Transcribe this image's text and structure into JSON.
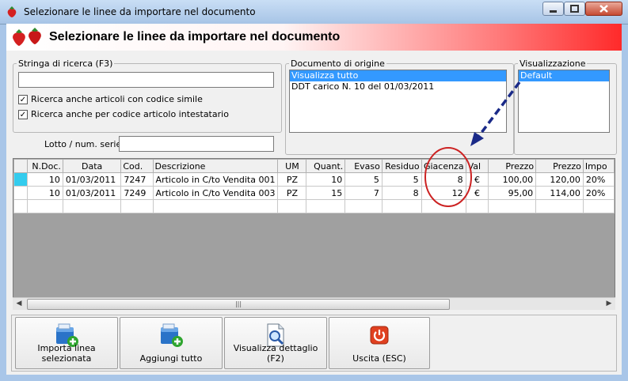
{
  "window": {
    "title": "Selezionare le linee da importare nel documento"
  },
  "banner": {
    "title": "Selezionare le linee da importare nel documento"
  },
  "search": {
    "legend": "Stringa di ricerca (F3)",
    "value": "",
    "check1": "Ricerca anche articoli con codice simile",
    "check2": "Ricerca anche per codice articolo intestatario",
    "lotto_label": "Lotto / num. serie :",
    "lotto_value": ""
  },
  "origin": {
    "legend": "Documento di origine",
    "items": [
      "Visualizza tutto",
      "DDT carico N. 10 del 01/03/2011"
    ]
  },
  "view": {
    "legend": "Visualizzazione",
    "items": [
      "Default"
    ]
  },
  "grid": {
    "headers": [
      "N.Doc.",
      "Data",
      "Cod.",
      "Descrizione",
      "UM",
      "Quant.",
      "Evaso",
      "Residuo",
      "Giacenza",
      "Val",
      "Prezzo",
      "Prezzo",
      "Impo"
    ],
    "rows": [
      [
        "10",
        "01/03/2011",
        "7247",
        "Articolo in C/to Vendita 001",
        "PZ",
        "10",
        "5",
        "5",
        "8",
        "€",
        "100,00",
        "120,00",
        "20%"
      ],
      [
        "10",
        "01/03/2011",
        "7249",
        "Articolo in C/to Vendita 003",
        "PZ",
        "15",
        "7",
        "8",
        "12",
        "€",
        "95,00",
        "114,00",
        "20%"
      ]
    ]
  },
  "toolbar": {
    "import_label": "Importa linea selezionata",
    "add_all_label": "Aggiungi tutto",
    "detail_label": "Visualizza dettaglio (F2)",
    "exit_label": "Uscita (ESC)"
  },
  "colors": {
    "banner_red": "#ff2a2a",
    "highlight": "#cc2222",
    "arrow": "#1a2a88",
    "selection": "#3399ff"
  }
}
